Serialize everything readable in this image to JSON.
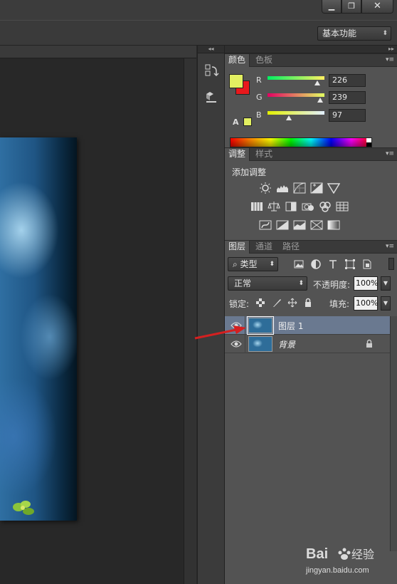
{
  "window": {
    "minimize": "▁",
    "restore": "❐",
    "close": "✕"
  },
  "options_bar": {
    "workspace": "基本功能"
  },
  "color_panel": {
    "tabs": [
      "颜色",
      "色板"
    ],
    "channels": [
      {
        "label": "R",
        "value": "226",
        "gradient": "linear-gradient(90deg,#00ef61,#fff061)"
      },
      {
        "label": "G",
        "value": "239",
        "gradient": "linear-gradient(90deg,#e20061,#e2ff61)"
      },
      {
        "label": "B",
        "value": "97",
        "gradient": "linear-gradient(90deg,#e2ef00,#e2efff)"
      }
    ],
    "foreground": "#e2ef61",
    "background": "#e8181c"
  },
  "adjustments_panel": {
    "tabs": [
      "调整",
      "样式"
    ],
    "title": "添加调整"
  },
  "layers_panel": {
    "tabs": [
      "图层",
      "通道",
      "路径"
    ],
    "filter_kind": "类型",
    "blend_mode": "正常",
    "opacity_label": "不透明度:",
    "opacity_value": "100%",
    "lock_label": "锁定:",
    "fill_label": "填充:",
    "fill_value": "100%",
    "layers": [
      {
        "name": "图层 1",
        "selected": true,
        "locked": false
      },
      {
        "name": "背景",
        "selected": false,
        "locked": true
      }
    ]
  },
  "annotation": {
    "arrow_color": "#d42020"
  },
  "watermark": {
    "brand": "Bai",
    "brand2": "经验",
    "url": "jingyan.baidu.com"
  }
}
